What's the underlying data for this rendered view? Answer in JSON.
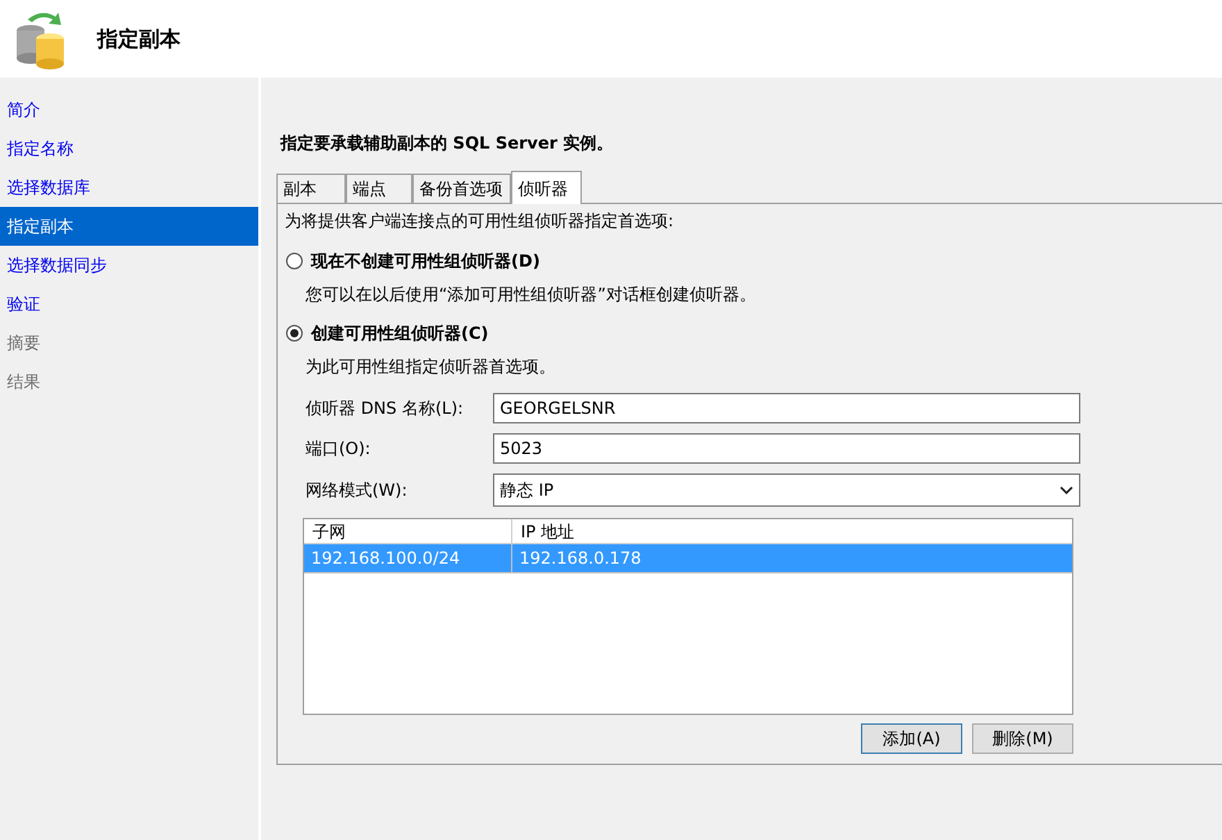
{
  "header": {
    "title": "指定副本"
  },
  "sidebar": {
    "items": [
      {
        "label": "简介",
        "selected": false,
        "disabled": false
      },
      {
        "label": "指定名称",
        "selected": false,
        "disabled": false
      },
      {
        "label": "选择数据库",
        "selected": false,
        "disabled": false
      },
      {
        "label": "指定副本",
        "selected": true,
        "disabled": false
      },
      {
        "label": "选择数据同步",
        "selected": false,
        "disabled": false
      },
      {
        "label": "验证",
        "selected": false,
        "disabled": false
      },
      {
        "label": "摘要",
        "selected": false,
        "disabled": true
      },
      {
        "label": "结果",
        "selected": false,
        "disabled": true
      }
    ]
  },
  "instruction": "指定要承载辅助副本的 SQL Server 实例。",
  "tabs": [
    {
      "label": "副本",
      "selected": false
    },
    {
      "label": "端点",
      "selected": false
    },
    {
      "label": "备份首选项",
      "selected": false
    },
    {
      "label": "侦听器",
      "selected": true
    }
  ],
  "panel": {
    "intro": "为将提供客户端连接点的可用性组侦听器指定首选项:",
    "options": [
      {
        "label": "现在不创建可用性组侦听器(D)",
        "selected": false,
        "description": "您可以在以后使用“添加可用性组侦听器”对话框创建侦听器。"
      },
      {
        "label": "创建可用性组侦听器(C)",
        "selected": true,
        "description": "为此可用性组指定侦听器首选项。"
      }
    ],
    "fields": [
      {
        "kind": "text",
        "label": "侦听器 DNS 名称(L):",
        "value": "GEORGELSNR"
      },
      {
        "kind": "text",
        "label": "端口(O):",
        "value": "5023"
      },
      {
        "kind": "dropdown",
        "label": "网络模式(W):",
        "value": "静态 IP"
      }
    ],
    "table": {
      "columns": [
        "子网",
        "IP 地址"
      ],
      "rows": [
        {
          "cells": [
            "192.168.100.0/24",
            "192.168.0.178"
          ],
          "selected": true
        }
      ]
    },
    "buttons": [
      "添加(A)",
      "删除(M)"
    ]
  }
}
